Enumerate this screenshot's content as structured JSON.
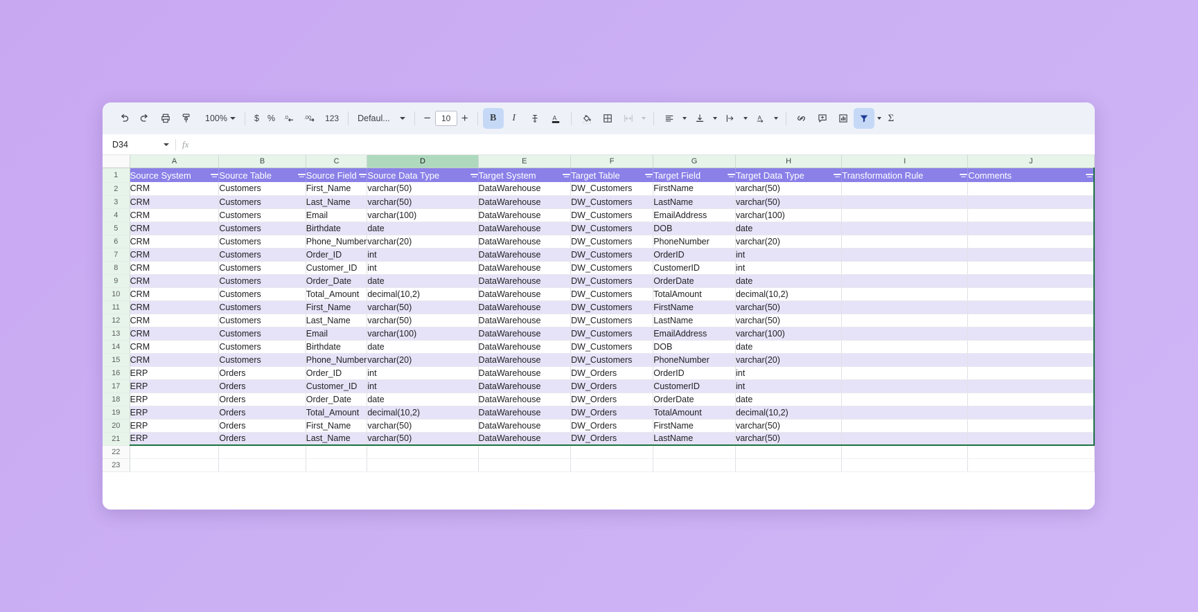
{
  "toolbar": {
    "undo_icon": "undo-icon",
    "redo_icon": "redo-icon",
    "print_icon": "print-icon",
    "paint_format_icon": "paint-format-icon",
    "zoom_value": "100%",
    "currency_label": "$",
    "percent_label": "%",
    "decrease_decimal_label": ".0",
    "increase_decimal_label": ".00",
    "more_formats_label": "123",
    "font_family": "Defaul...",
    "font_decrease": "−",
    "font_size": "10",
    "font_increase": "+",
    "bold_label": "B",
    "italic_label": "I",
    "strikethrough_icon": "strikethrough-icon",
    "text_color_label": "A",
    "fill_color_icon": "fill-color-icon",
    "borders_icon": "borders-icon",
    "merge_cells_icon": "merge-cells-icon",
    "horizontal_align_icon": "horizontal-align-icon",
    "vertical_align_icon": "vertical-align-icon",
    "text_wrap_icon": "text-wrap-icon",
    "text_rotation_icon": "text-rotation-icon",
    "insert_link_icon": "insert-link-icon",
    "insert_comment_icon": "insert-comment-icon",
    "insert_chart_icon": "insert-chart-icon",
    "filter_icon": "filter-icon",
    "functions_label": "Σ"
  },
  "formula_bar": {
    "cell_reference": "D34",
    "fx_label": "fx",
    "formula_value": "",
    "formula_placeholder": ""
  },
  "grid": {
    "columns": [
      "A",
      "B",
      "C",
      "D",
      "E",
      "F",
      "G",
      "H",
      "I",
      "J"
    ],
    "selected_column": "D",
    "row_numbers": [
      "1",
      "2",
      "3",
      "4",
      "5",
      "6",
      "7",
      "8",
      "9",
      "10",
      "11",
      "12",
      "13",
      "14",
      "15",
      "16",
      "17",
      "18",
      "19",
      "20",
      "21",
      "22",
      "23"
    ],
    "header_row_number": "1",
    "headers": [
      "Source System",
      "Source Table",
      "Source Field",
      "Source Data Type",
      "Target System",
      "Target Table",
      "Target Field",
      "Target Data Type",
      "Transformation Rule",
      "Comments"
    ],
    "rows": [
      [
        "CRM",
        "Customers",
        "First_Name",
        "varchar(50)",
        "DataWarehouse",
        "DW_Customers",
        "FirstName",
        "varchar(50)",
        "",
        ""
      ],
      [
        "CRM",
        "Customers",
        "Last_Name",
        "varchar(50)",
        "DataWarehouse",
        "DW_Customers",
        "LastName",
        "varchar(50)",
        "",
        ""
      ],
      [
        "CRM",
        "Customers",
        "Email",
        "varchar(100)",
        "DataWarehouse",
        "DW_Customers",
        "EmailAddress",
        "varchar(100)",
        "",
        ""
      ],
      [
        "CRM",
        "Customers",
        "Birthdate",
        "date",
        "DataWarehouse",
        "DW_Customers",
        "DOB",
        "date",
        "",
        ""
      ],
      [
        "CRM",
        "Customers",
        "Phone_Number",
        "varchar(20)",
        "DataWarehouse",
        "DW_Customers",
        "PhoneNumber",
        "varchar(20)",
        "",
        ""
      ],
      [
        "CRM",
        "Customers",
        "Order_ID",
        "int",
        "DataWarehouse",
        "DW_Customers",
        "OrderID",
        "int",
        "",
        ""
      ],
      [
        "CRM",
        "Customers",
        "Customer_ID",
        "int",
        "DataWarehouse",
        "DW_Customers",
        "CustomerID",
        "int",
        "",
        ""
      ],
      [
        "CRM",
        "Customers",
        "Order_Date",
        "date",
        "DataWarehouse",
        "DW_Customers",
        "OrderDate",
        "date",
        "",
        ""
      ],
      [
        "CRM",
        "Customers",
        "Total_Amount",
        "decimal(10,2)",
        "DataWarehouse",
        "DW_Customers",
        "TotalAmount",
        "decimal(10,2)",
        "",
        ""
      ],
      [
        "CRM",
        "Customers",
        "First_Name",
        "varchar(50)",
        "DataWarehouse",
        "DW_Customers",
        "FirstName",
        "varchar(50)",
        "",
        ""
      ],
      [
        "CRM",
        "Customers",
        "Last_Name",
        "varchar(50)",
        "DataWarehouse",
        "DW_Customers",
        "LastName",
        "varchar(50)",
        "",
        ""
      ],
      [
        "CRM",
        "Customers",
        "Email",
        "varchar(100)",
        "DataWarehouse",
        "DW_Customers",
        "EmailAddress",
        "varchar(100)",
        "",
        ""
      ],
      [
        "CRM",
        "Customers",
        "Birthdate",
        "date",
        "DataWarehouse",
        "DW_Customers",
        "DOB",
        "date",
        "",
        ""
      ],
      [
        "CRM",
        "Customers",
        "Phone_Number",
        "varchar(20)",
        "DataWarehouse",
        "DW_Customers",
        "PhoneNumber",
        "varchar(20)",
        "",
        ""
      ],
      [
        "ERP",
        "Orders",
        "Order_ID",
        "int",
        "DataWarehouse",
        "DW_Orders",
        "OrderID",
        "int",
        "",
        ""
      ],
      [
        "ERP",
        "Orders",
        "Customer_ID",
        "int",
        "DataWarehouse",
        "DW_Orders",
        "CustomerID",
        "int",
        "",
        ""
      ],
      [
        "ERP",
        "Orders",
        "Order_Date",
        "date",
        "DataWarehouse",
        "DW_Orders",
        "OrderDate",
        "date",
        "",
        ""
      ],
      [
        "ERP",
        "Orders",
        "Total_Amount",
        "decimal(10,2)",
        "DataWarehouse",
        "DW_Orders",
        "TotalAmount",
        "decimal(10,2)",
        "",
        ""
      ],
      [
        "ERP",
        "Orders",
        "First_Name",
        "varchar(50)",
        "DataWarehouse",
        "DW_Orders",
        "FirstName",
        "varchar(50)",
        "",
        ""
      ],
      [
        "ERP",
        "Orders",
        "Last_Name",
        "varchar(50)",
        "DataWarehouse",
        "DW_Orders",
        "LastName",
        "varchar(50)",
        "",
        ""
      ]
    ],
    "empty_rows": 2
  },
  "colors": {
    "header_banner": "#8a80e8",
    "band_alt": "#e6e3f8",
    "col_header": "#e6f4ea",
    "col_header_selected": "#aed9bd",
    "range_border": "#1a7340",
    "page_background": "#cbb0f4"
  }
}
